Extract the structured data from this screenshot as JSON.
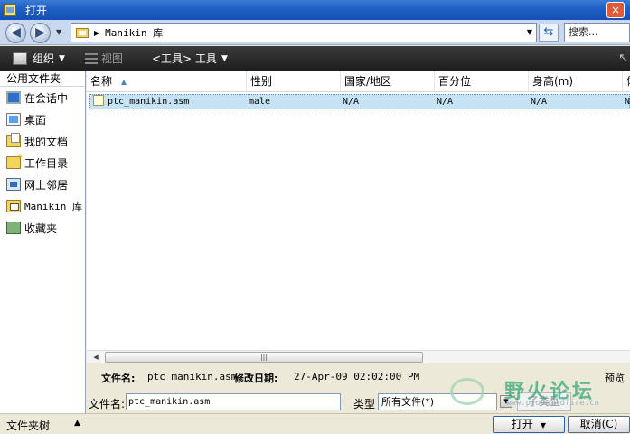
{
  "window": {
    "title": "打开",
    "close_label": "×"
  },
  "address": {
    "path": "Manikin 库",
    "search_placeholder": "搜索..."
  },
  "toolbar": {
    "organize_label": "组织",
    "view_label": "视图",
    "tools_label": "<工具> 工具"
  },
  "sidebar": {
    "header": "公用文件夹",
    "items": [
      {
        "label": "在会话中",
        "icon": "monitor-icon"
      },
      {
        "label": "桌面",
        "icon": "desktop-icon"
      },
      {
        "label": "我的文档",
        "icon": "documents-icon"
      },
      {
        "label": "工作目录",
        "icon": "working-directory-icon"
      },
      {
        "label": "网上邻居",
        "icon": "network-icon"
      },
      {
        "label": "Manikin 库",
        "icon": "library-icon"
      },
      {
        "label": "收藏夹",
        "icon": "favorites-icon"
      }
    ]
  },
  "file_list": {
    "columns": [
      "名称",
      "性别",
      "国家/地区",
      "百分位",
      "身高(m)",
      "体"
    ],
    "sorted_column": "名称",
    "rows": [
      {
        "name": "ptc_manikin.asm",
        "gender": "male",
        "region": "N/A",
        "percentile": "N/A",
        "height": "N/A",
        "extra": "N"
      }
    ]
  },
  "details": {
    "filename_label": "文件名:",
    "filename_value": "ptc_manikin.asm",
    "modified_label": "修改日期:",
    "modified_value": "27-Apr-09 02:02:00 PM",
    "preview_label": "预览"
  },
  "bottom": {
    "filename_label": "文件名:",
    "filename_value": "ptc_manikin.asm",
    "type_label": "类型",
    "type_value": "所有文件(*)",
    "subtype_label": "子类型"
  },
  "statusbar": {
    "folder_tree_label": "文件夹树"
  },
  "buttons": {
    "open_label": "打开",
    "cancel_label": "取消(C)"
  },
  "watermark": {
    "text": "野火论坛",
    "url": "www.proewildfire.cn"
  }
}
